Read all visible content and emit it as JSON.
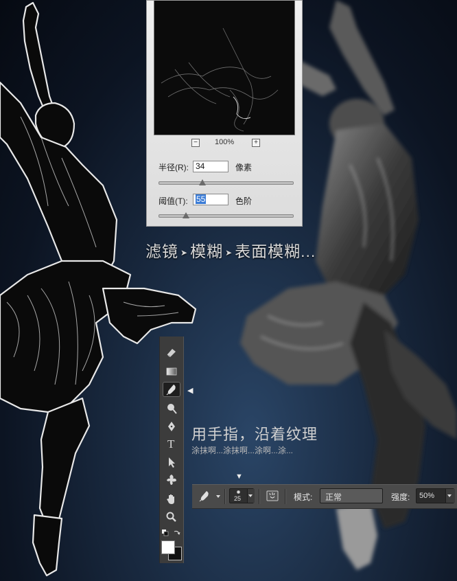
{
  "dialog": {
    "zoom_out": "−",
    "zoom_value": "100%",
    "zoom_in": "+",
    "radius": {
      "label": "半径(R):",
      "value": "34",
      "unit": "像素",
      "level": 0.34
    },
    "threshold": {
      "label": "阈值(T):",
      "value": "55",
      "unit": "色阶",
      "level": 0.21
    }
  },
  "captions": {
    "menu_path": [
      "滤镜",
      "模糊",
      "表面模糊..."
    ],
    "menu_separator": "➤",
    "instruction": "用手指，沿着纹理",
    "sub_instruction": "涂抹啊...涂抹啊...涂啊...涂..."
  },
  "toolbar": {
    "tools": [
      "eraser-icon",
      "gradient-icon",
      "smudge-icon",
      "dodge-icon",
      "pen-icon",
      "type-icon",
      "path-select-icon",
      "custom-shape-icon",
      "hand-icon",
      "zoom-icon"
    ],
    "active_tool": "smudge-icon",
    "type_glyph": "T",
    "pointer": "◀"
  },
  "options_bar": {
    "brush_size": "25",
    "mode_label": "模式:",
    "mode_value": "正常",
    "strength_label": "强度:",
    "strength_value": "50%",
    "pointer": "▼"
  }
}
